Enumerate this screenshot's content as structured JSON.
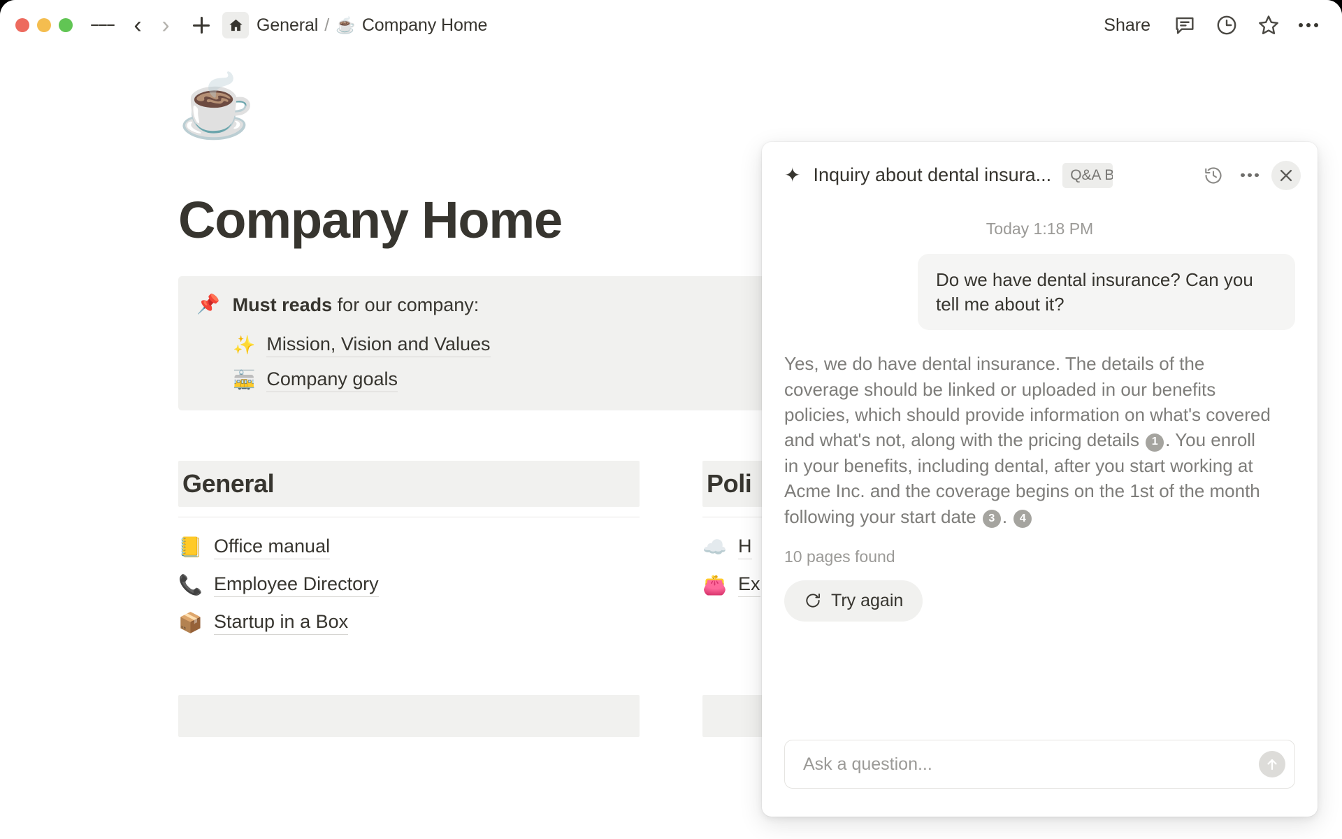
{
  "window": {
    "traffic_lights": [
      "close",
      "minimize",
      "maximize"
    ]
  },
  "topbar": {
    "menu_icon": "hamburger-icon",
    "back_icon": "chevron-left-icon",
    "forward_icon": "chevron-right-icon",
    "new_icon": "plus-icon",
    "home_icon": "home-icon",
    "breadcrumb": {
      "parent": "General",
      "separator": "/",
      "current_emoji": "☕",
      "current": "Company Home"
    },
    "share_label": "Share",
    "comment_icon": "comment-icon",
    "history_icon": "clock-history-icon",
    "favorite_icon": "star-icon",
    "more_icon": "more-horizontal-icon"
  },
  "page": {
    "emoji": "☕",
    "title": "Company Home",
    "callout": {
      "emoji": "📌",
      "lead_bold": "Must reads",
      "lead_rest": " for our company:",
      "links": [
        {
          "emoji": "✨",
          "label": "Mission, Vision and Values"
        },
        {
          "emoji": "🚋",
          "label": "Company goals"
        }
      ]
    },
    "columns": [
      {
        "heading": "General",
        "links": [
          {
            "emoji": "📒",
            "label": "Office manual"
          },
          {
            "emoji": "📞",
            "label": "Employee Directory"
          },
          {
            "emoji": "📦",
            "label": "Startup in a Box"
          }
        ]
      },
      {
        "heading": "Poli",
        "links": [
          {
            "emoji": "☁️",
            "label": "H"
          },
          {
            "emoji": "👛",
            "label": "Ex"
          }
        ]
      }
    ]
  },
  "ai_panel": {
    "sparkle_icon": "sparkle-icon",
    "title": "Inquiry about dental insura...",
    "badge": "Q&A B",
    "history_icon": "history-icon",
    "more_icon": "more-horizontal-icon",
    "close_icon": "close-icon",
    "timestamp": "Today 1:18 PM",
    "user_message": "Do we have dental insurance? Can you tell me about it?",
    "answer": {
      "part1": "Yes, we do have dental insurance. The details of the coverage should be linked or uploaded in our benefits policies, which should provide information on what's covered and what's not, along with the pricing details ",
      "cite1": "1",
      "part2": ". You enroll in your benefits, including dental, after you start working at Acme Inc. and the coverage begins on the 1st of the month following your start date ",
      "cite2": "3",
      "part3": ". ",
      "cite3": "4"
    },
    "pages_found": "10 pages found",
    "try_again_label": "Try again",
    "try_again_icon": "refresh-icon",
    "input_placeholder": "Ask a question...",
    "send_icon": "arrow-up-icon"
  },
  "colors": {
    "accent_gray": "#f1f1ef",
    "text": "#37352f",
    "muted": "#9b9a97",
    "answer_text": "#7e7d7a",
    "citation_bg": "#a5a49f"
  }
}
